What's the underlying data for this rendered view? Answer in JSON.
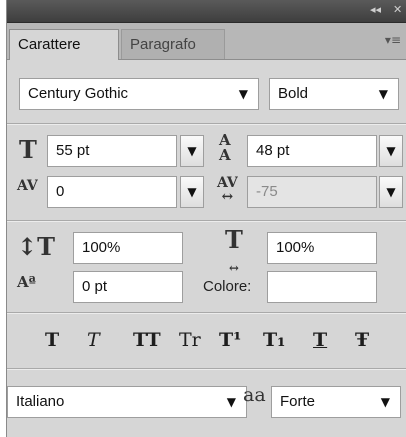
{
  "titlebar": {
    "collapse": "◂◂",
    "close": "✕"
  },
  "tabs": [
    {
      "label": "Carattere",
      "active": true
    },
    {
      "label": "Paragrafo",
      "active": false
    }
  ],
  "tab_menu_icon": "▾≡",
  "font_family": {
    "value": "Century Gothic"
  },
  "font_style": {
    "value": "Bold"
  },
  "font_size": {
    "icon": "font-size-icon",
    "value": "55 pt"
  },
  "leading": {
    "icon": "leading-icon",
    "value": "48 pt"
  },
  "kerning": {
    "icon": "kerning-icon",
    "value": "0"
  },
  "tracking": {
    "icon": "tracking-icon",
    "value": "-75"
  },
  "vertical_scale": {
    "icon": "vertical-scale-icon",
    "value": "100%"
  },
  "horizontal_scale": {
    "icon": "horizontal-scale-icon",
    "value": "100%"
  },
  "baseline_shift": {
    "icon": "baseline-shift-icon",
    "value": "0 pt"
  },
  "color": {
    "label": "Colore:",
    "swatch": "#ffffff"
  },
  "style_buttons": [
    {
      "name": "faux-bold",
      "glyph": "T"
    },
    {
      "name": "faux-italic",
      "glyph": "T"
    },
    {
      "name": "all-caps",
      "glyph": "TT"
    },
    {
      "name": "small-caps",
      "glyph": "Tr"
    },
    {
      "name": "superscript",
      "glyph": "T¹"
    },
    {
      "name": "subscript",
      "glyph": "T₁"
    },
    {
      "name": "underline",
      "glyph": "T"
    },
    {
      "name": "strikethrough",
      "glyph": "Ŧ"
    }
  ],
  "language": {
    "value": "Italiano"
  },
  "antialias": {
    "icon_text": "aa",
    "value": "Forte"
  },
  "dropdown_caret": "▼"
}
